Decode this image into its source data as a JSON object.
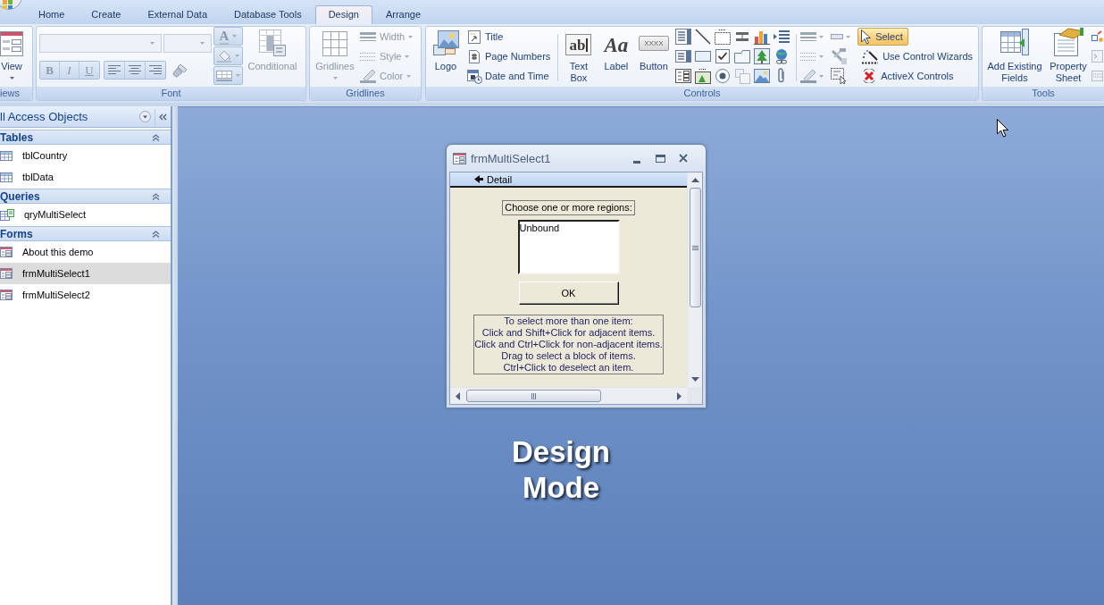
{
  "tabs": [
    {
      "label": "Home",
      "selected": false
    },
    {
      "label": "Create",
      "selected": false
    },
    {
      "label": "External Data",
      "selected": false
    },
    {
      "label": "Database Tools",
      "selected": false
    },
    {
      "label": "Design",
      "selected": true
    },
    {
      "label": "Arrange",
      "selected": false
    }
  ],
  "ribbon": {
    "views": {
      "button": "View",
      "label": "iews"
    },
    "font": {
      "disabled": true,
      "format_buttons": [
        "B",
        "I",
        "U"
      ],
      "font_color": "A",
      "conditional": "Conditional",
      "label": "Font"
    },
    "gridlines": {
      "disabled": true,
      "button": "Gridlines",
      "options": [
        "Width",
        "Style",
        "Color"
      ],
      "label": "Gridlines"
    },
    "controls": {
      "logo": "Logo",
      "header_footer": [
        "Title",
        "Page Numbers",
        "Date and Time"
      ],
      "large_buttons": [
        {
          "kind": "text_box",
          "label": "Text Box",
          "sample": "ab"
        },
        {
          "kind": "label",
          "label": "Label",
          "sample": "Aa"
        },
        {
          "kind": "button",
          "label": "Button",
          "sample": "XXXX"
        }
      ],
      "modes": [
        {
          "kind": "select",
          "label": "Select",
          "selected": true
        },
        {
          "kind": "wizard",
          "label": "Use Control Wizards",
          "selected": false
        },
        {
          "kind": "activex",
          "label": "ActiveX Controls",
          "selected": false
        }
      ],
      "label": "Controls"
    },
    "tools": {
      "buttons": [
        "Add Existing Fields",
        "Property Sheet"
      ],
      "label": "Tools"
    }
  },
  "nav_pane": {
    "title": "ll Access Objects",
    "groups": [
      {
        "label": "Tables",
        "expanded": true,
        "items": [
          {
            "kind": "table",
            "label": "tblCountry",
            "selected": false
          },
          {
            "kind": "table",
            "label": "tblData",
            "selected": false
          }
        ]
      },
      {
        "label": "Queries",
        "expanded": true,
        "items": [
          {
            "kind": "query",
            "label": "qryMultiSelect",
            "selected": false
          }
        ]
      },
      {
        "label": "Forms",
        "expanded": true,
        "items": [
          {
            "kind": "form",
            "label": "About this demo",
            "selected": false
          },
          {
            "kind": "form",
            "label": "frmMultiSelect1",
            "selected": true
          },
          {
            "kind": "form",
            "label": "frmMultiSelect2",
            "selected": false
          }
        ]
      }
    ]
  },
  "form_window": {
    "title": "frmMultiSelect1",
    "section": "Detail",
    "prompt": "Choose one or more regions:",
    "list_box": {
      "value": "Unbound"
    },
    "ok_button": "OK",
    "instructions": [
      "To select more than one item:",
      "Click and Shift+Click for adjacent items.",
      "Click and Ctrl+Click for non-adjacent items.",
      "Drag to select a block of items.",
      "Ctrl+Click to deselect an item."
    ]
  },
  "caption": "Design Mode"
}
